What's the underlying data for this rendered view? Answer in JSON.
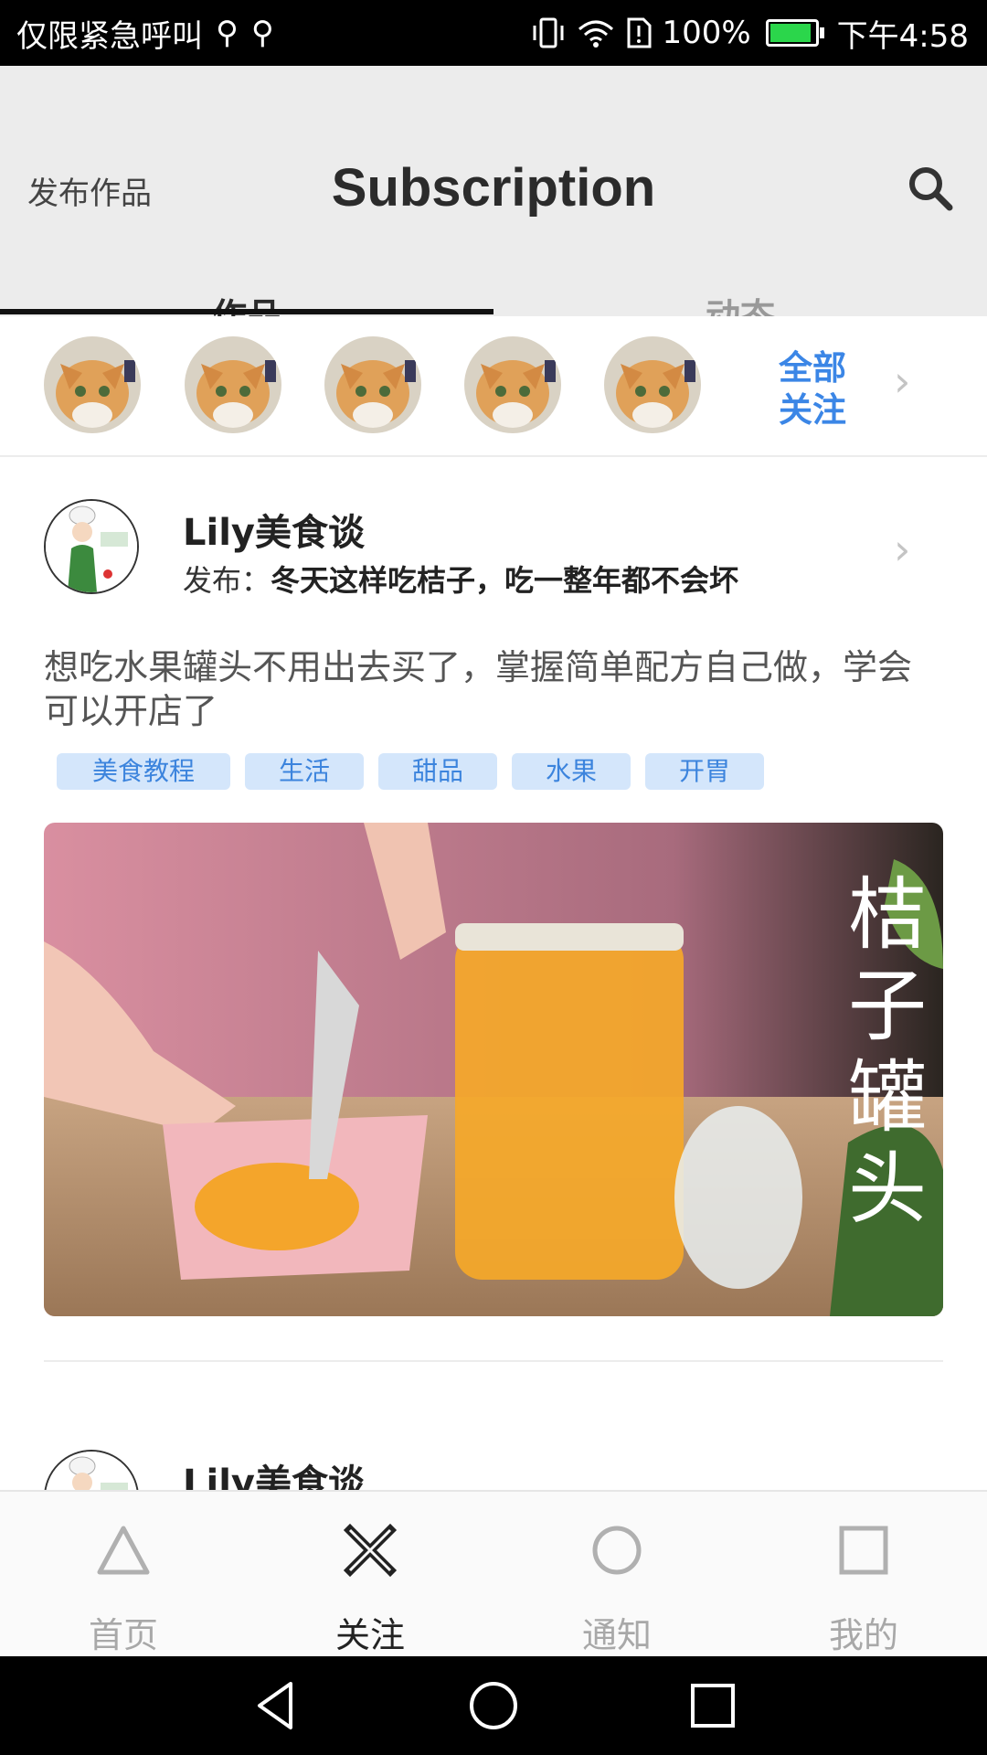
{
  "status_bar": {
    "carrier": "仅限紧急呼叫",
    "battery": "100%",
    "battery_level": 1.0,
    "time": "下午4:58"
  },
  "header": {
    "publish_label": "发布作品",
    "title": "Subscription",
    "tabs": [
      {
        "label": "作品",
        "active": true
      },
      {
        "label": "动态",
        "active": false
      }
    ]
  },
  "follow_row": {
    "avatars": [
      "cat-avatar",
      "cat-avatar",
      "cat-avatar",
      "cat-avatar",
      "cat-avatar"
    ],
    "all_label_line1": "全部",
    "all_label_line2": "关注"
  },
  "post": {
    "author": "Lily美食谈",
    "publish_prefix": "发布：",
    "publish_title": "冬天这样吃桔子，吃一整年都不会坏",
    "description": "想吃水果罐头不用出去买了，掌握简单配方自己做，学会可以开店了",
    "tags": [
      "美食教程",
      "生活",
      "甜品",
      "水果",
      "开胃"
    ],
    "image_caption": "桔子罐头"
  },
  "next_post": {
    "author": "Lily美食谈"
  },
  "bottom_nav": [
    {
      "label": "首页",
      "icon": "triangle-icon",
      "active": false
    },
    {
      "label": "关注",
      "icon": "cross-icon",
      "active": true
    },
    {
      "label": "通知",
      "icon": "circle-icon",
      "active": false
    },
    {
      "label": "我的",
      "icon": "square-icon",
      "active": false
    }
  ],
  "colors": {
    "accent": "#3b86e6",
    "tag_bg": "#d4e6fb",
    "header_bg": "#ececec"
  }
}
